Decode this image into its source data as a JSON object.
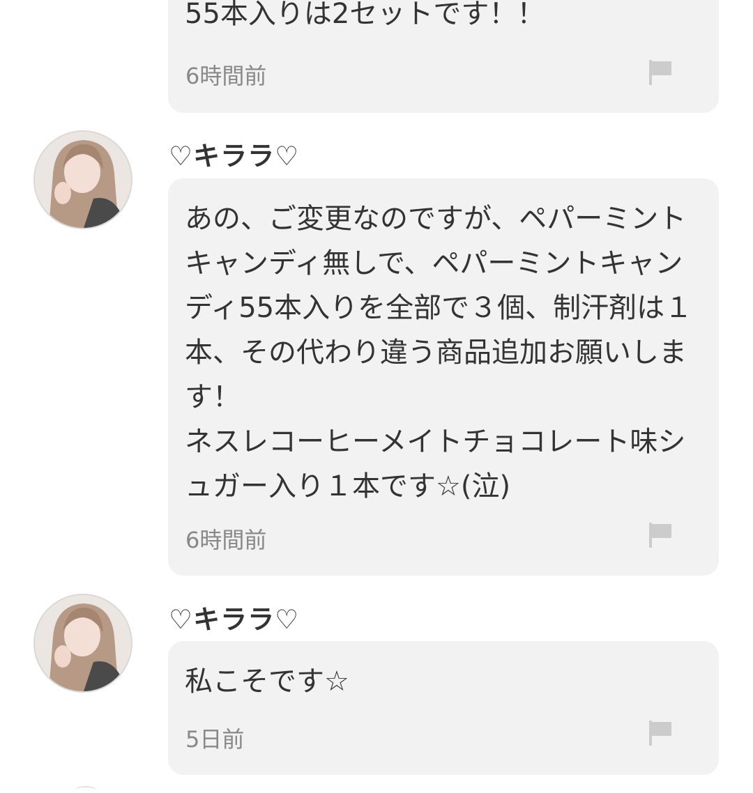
{
  "comments": [
    {
      "body": "55本入りは2セットです！！",
      "time": "6時間前",
      "flag_icon": "flag-icon"
    },
    {
      "username": "♡キララ♡",
      "body": "あの、ご変更なのですが、ペパーミントキャンディ無しで、ペパーミントキャンディ55本入りを全部で３個、制汗剤は１本、その代わり違う商品追加お願いします！\nネスレコーヒーメイトチョコレート味シュガー入り１本です☆(泣)",
      "time": "6時間前",
      "flag_icon": "flag-icon"
    },
    {
      "username": "♡キララ♡",
      "body": "私こそです☆",
      "time": "5日前",
      "flag_icon": "flag-icon"
    }
  ],
  "colors": {
    "bubble_bg": "#f2f2f2",
    "text": "#333333",
    "time": "#888888",
    "flag": "#cccccc"
  }
}
